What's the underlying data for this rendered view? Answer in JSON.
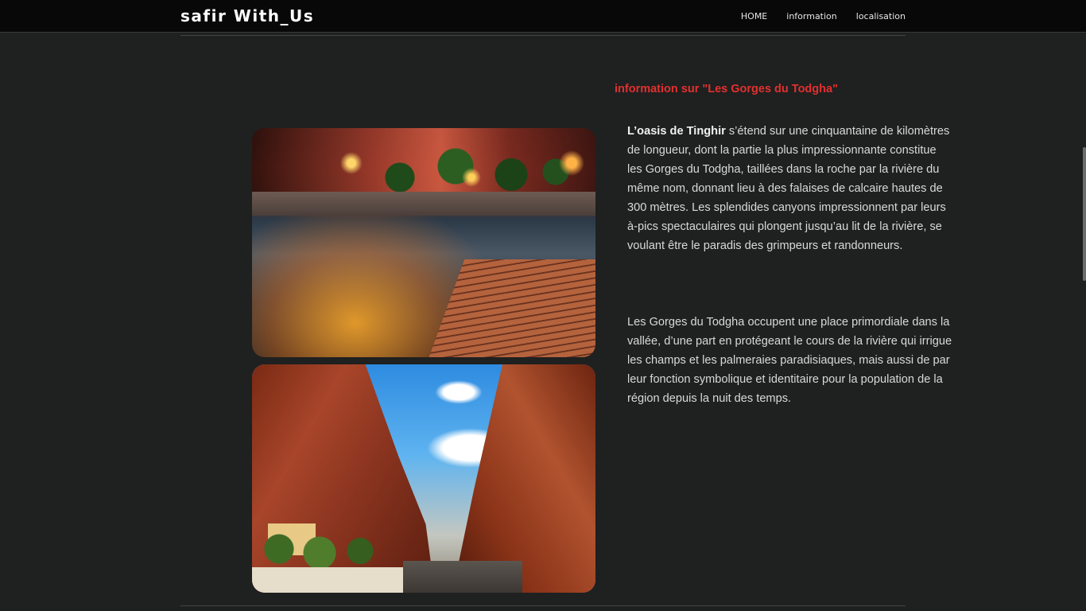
{
  "navbar": {
    "brand": "safir With_Us",
    "links": [
      {
        "label": "HOME"
      },
      {
        "label": "information"
      },
      {
        "label": "localisation"
      }
    ]
  },
  "content": {
    "heading": "information sur \"Les Gorges du Todgha\"",
    "paragraph1_bold": "L’oasis de Tinghir",
    "paragraph1_rest": " s’étend sur une cinquantaine de kilomètres de longueur, dont la partie la plus impressionnante constitue les Gorges du Todgha, taillées dans la roche par la rivière du même nom, donnant lieu à des falaises de calcaire hautes de 300 mètres. Les splendides canyons impressionnent par leurs à-pics spectaculaires qui plongent jusqu’au lit de la rivière, se voulant être le paradis des grimpeurs et randonneurs.",
    "paragraph2": "Les Gorges du Todgha occupent une place primordiale dans la vallée, d’une part en protégeant le cours de la rivière qui irrigue les champs et les palmeraies paradisiaques, mais aussi de par leur fonction symbolique et identitaire pour la population de la région depuis la nuit des temps."
  },
  "colors": {
    "background": "#1f2020",
    "navbar": "#080808",
    "heading": "#e0312f",
    "text": "#d9d9d9"
  }
}
